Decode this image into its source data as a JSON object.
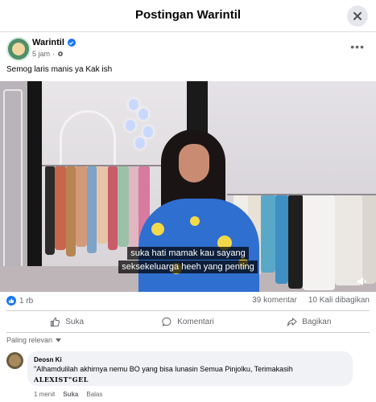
{
  "header": {
    "title": "Postingan Warintil"
  },
  "post": {
    "author": "Warintil",
    "time": "5 jam",
    "caption": "Semog laris manis ya Kak ish"
  },
  "video": {
    "subtitle_line1": "suka hati mamak kau sayang",
    "subtitle_line2": "seksekeluarga heeh yang penting"
  },
  "stats": {
    "likes": "1 rb",
    "comments": "39 komentar",
    "shares": "10 Kali dibagikan"
  },
  "actions": {
    "like": "Suka",
    "comment": "Komentari",
    "share": "Bagikan"
  },
  "comments_section": {
    "sort_label": "Paling relevan",
    "items": [
      {
        "author": "Deosn Ki",
        "text": "\"Alhamdulilah akhirnya nemu BO yang bisa lunasin Semua Pinjolku, Terimakasih",
        "signature": "ALEXIST\"GEL",
        "time": "1 menit",
        "like": "Suka",
        "reply": "Balas"
      }
    ]
  },
  "colors": {
    "accent": "#1877f2",
    "muted": "#65676b",
    "bubble": "#f0f2f5"
  },
  "icons": [
    "close-icon",
    "verified-icon",
    "globe-settings-icon",
    "more-icon",
    "like-icon",
    "comment-icon",
    "share-icon",
    "chevron-down-icon",
    "volume-icon"
  ]
}
